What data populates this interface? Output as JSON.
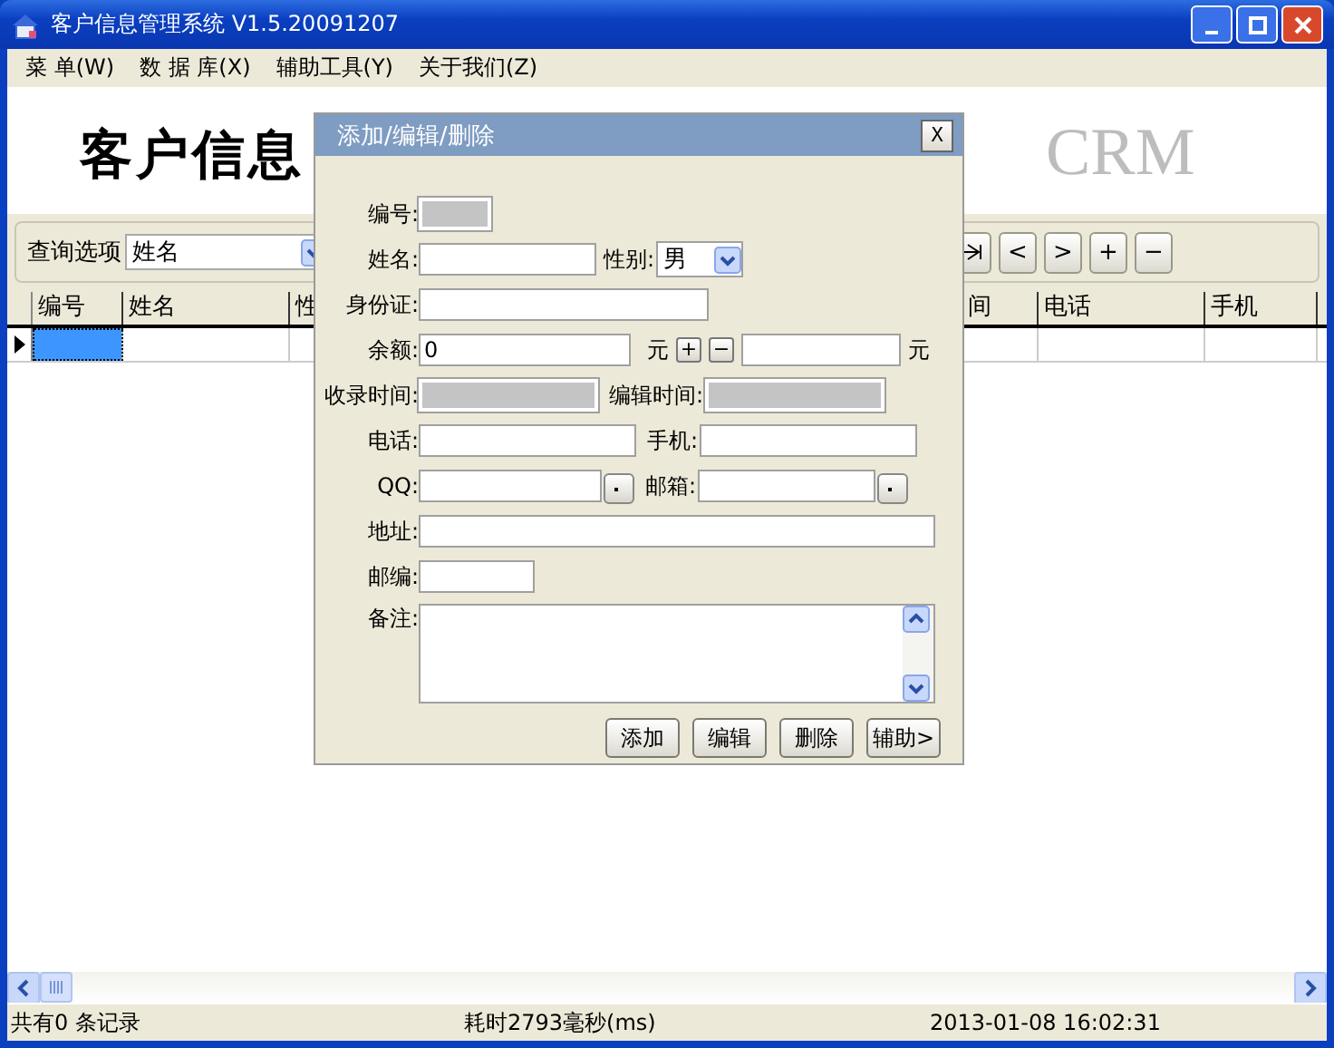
{
  "window": {
    "title": "客户信息管理系统 V1.5.20091207"
  },
  "menu": [
    "菜 单(W)",
    "数 据 库(X)",
    "辅助工具(Y)",
    "关于我们(Z)"
  ],
  "banner": {
    "title": "客户信息",
    "marks": [
      "CRM"
    ]
  },
  "query": {
    "label": "查询选项",
    "value": "姓名",
    "nav_buttons": [
      {
        "kind": "icon"
      },
      {
        "kind": "text",
        "label": "<"
      },
      {
        "kind": "text",
        "label": ">"
      },
      {
        "kind": "text",
        "label": "+"
      },
      {
        "kind": "text",
        "label": "−"
      }
    ]
  },
  "grid": {
    "columns": [
      "编号",
      "姓名",
      "性",
      "间",
      "电话",
      "手机"
    ],
    "rows": [
      {
        "selected": true
      }
    ]
  },
  "status_bar": [
    "共有0 条记录",
    "耗时2793毫秒(ms)",
    "2013-01-08 16:02:31"
  ],
  "dialog": {
    "title": "添加/编辑/删除",
    "close": "X",
    "rows": [
      [
        {
          "kind": "readonly",
          "label": "编号:"
        }
      ],
      [
        {
          "kind": "text",
          "label": "姓名:"
        },
        {
          "kind": "select",
          "label": "性别:",
          "value": "男"
        }
      ],
      [
        {
          "kind": "text",
          "label": "身份证:"
        }
      ],
      [
        {
          "kind": "text",
          "label": "余额:",
          "value": "0"
        },
        {
          "kind": "unit",
          "text": "元"
        },
        {
          "kind": "step",
          "text": "+"
        },
        {
          "kind": "step",
          "text": "−"
        },
        {
          "kind": "text"
        },
        {
          "kind": "unit",
          "text": "元"
        }
      ],
      [
        {
          "kind": "readonly",
          "label": "收录时间:"
        },
        {
          "kind": "readonly",
          "label": "编辑时间:"
        }
      ],
      [
        {
          "kind": "text",
          "label": "电话:"
        },
        {
          "kind": "text",
          "label": "手机:"
        }
      ],
      [
        {
          "kind": "text",
          "label": "QQ:"
        },
        {
          "kind": "dot"
        },
        {
          "kind": "text",
          "label": "邮箱:"
        },
        {
          "kind": "dot"
        }
      ],
      [
        {
          "kind": "text",
          "label": "地址:"
        }
      ],
      [
        {
          "kind": "text",
          "label": "邮编:"
        }
      ],
      [
        {
          "kind": "textarea",
          "label": "备注:"
        }
      ]
    ],
    "buttons": [
      "添加",
      "编辑",
      "删除",
      "辅助>"
    ]
  }
}
